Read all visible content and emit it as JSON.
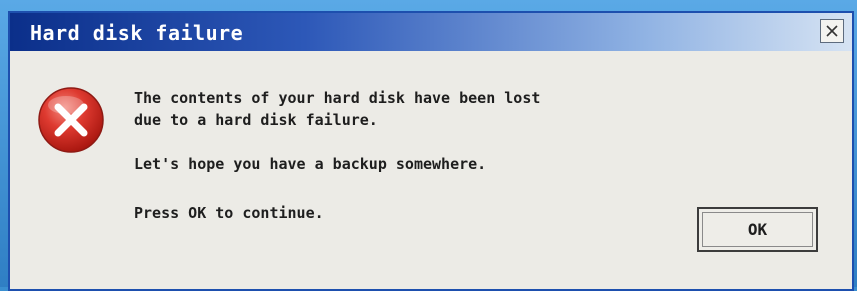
{
  "window": {
    "title": "Hard disk failure",
    "close_icon": "close-icon"
  },
  "message": {
    "icon": "error-icon",
    "line_1": "The contents of your hard disk have been lost",
    "line_2": "due to a hard disk failure.",
    "line_3": "Let's hope you have a backup somewhere.",
    "line_4": "Press OK to continue."
  },
  "buttons": {
    "ok_label": "OK"
  },
  "colors": {
    "titlebar_start": "#0b2f8a",
    "titlebar_end": "#d6e3f3",
    "dialog_bg": "#ecebe6",
    "error_red": "#d9322b"
  }
}
